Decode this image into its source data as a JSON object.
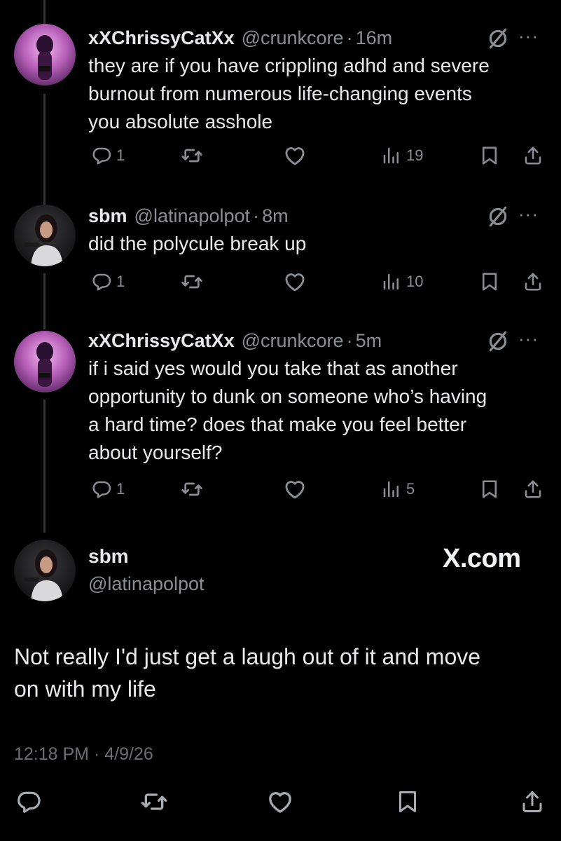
{
  "tweets": [
    {
      "name": "xXChrissyCatXx",
      "handle": "@crunkcore",
      "time": "16m",
      "text_lines": [
        "they are if you have crippling adhd and severe",
        "burnout from numerous life-changing events",
        "you absolute asshole"
      ],
      "replies": "1",
      "views": "19"
    },
    {
      "name": "sbm",
      "handle": "@latinapolpot",
      "time": "8m",
      "text_lines": [
        "did the polycule break up"
      ],
      "replies": "1",
      "views": "10"
    },
    {
      "name": "xXChrissyCatXx",
      "handle": "@crunkcore",
      "time": "5m",
      "text_lines": [
        "if i said yes would you take that as another",
        "opportunity to dunk on someone who’s having",
        "a hard time? does that make you feel better",
        "about yourself?"
      ],
      "replies": "1",
      "views": "5"
    }
  ],
  "main_tweet": {
    "name": "sbm",
    "handle": "@latinapolpot",
    "watermark": "X.com",
    "text_lines": [
      "Not really I'd just get a laugh out of it and move",
      "on with my life"
    ],
    "timestamp": "12:18 PM · 4/9/26"
  },
  "separator_dot": "·",
  "more_glyph": "···",
  "icons": {
    "reply": "reply-icon",
    "retweet": "retweet-icon",
    "like": "like-icon",
    "views": "views-icon",
    "bookmark": "bookmark-icon",
    "share": "share-icon",
    "grok": "grok-icon"
  },
  "colors": {
    "background": "#000000",
    "text": "#e7e9ea",
    "secondary": "#8b8f94",
    "thread_line": "#333639"
  }
}
